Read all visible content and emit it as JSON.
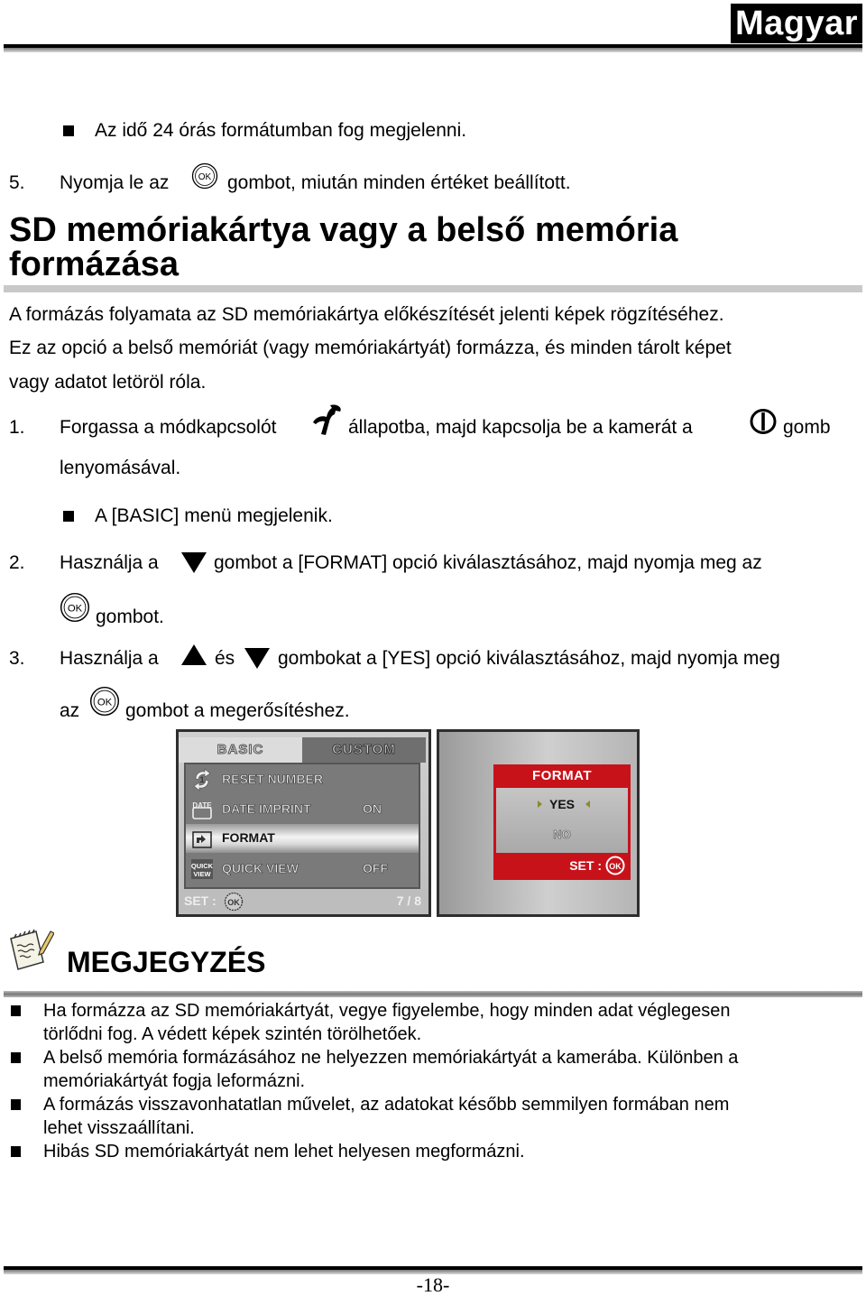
{
  "header": {
    "language_tab": "Magyar"
  },
  "intro": {
    "bullet": "Az idő 24 órás formátumban fog megjelenni.",
    "step5": {
      "number": "5.",
      "before": "Nyomja le az",
      "icon": "ok-button-icon",
      "after": "gombot, miután minden értéket beállított."
    }
  },
  "section": {
    "title_line1": "SD memóriakártya vagy a belső memória",
    "title_line2": "formázása",
    "paragraph_lines": [
      "A formázás folyamata az SD memóriakártya előkészítését jelenti képek rögzítéséhez.",
      "Ez az opció a belső memóriát (vagy memóriakártyát) formázza, és minden tárolt képet",
      "vagy adatot letöröl róla."
    ]
  },
  "steps": [
    {
      "number": "1.",
      "line1_a": "Forgassa a módkapcsolót",
      "icon1": "wrench-setup-icon",
      "line1_b": "állapotba, majd kapcsolja be a kamerát a",
      "icon2": "power-icon",
      "line1_c": "gomb",
      "line2": "lenyomásával.",
      "bullet": "A [BASIC] menü megjelenik."
    },
    {
      "number": "2.",
      "line1_a": "Használja a",
      "icon1": "down-arrow-icon",
      "line1_b": "gombot a [FORMAT] opció kiválasztásához, majd nyomja meg az",
      "icon2": "ok-button-icon",
      "line2": "gombot."
    },
    {
      "number": "3.",
      "line1_a": "Használja a",
      "icon1": "up-arrow-icon",
      "line1_b": "és",
      "icon2": "down-arrow-icon",
      "line1_c": "gombokat a [YES] opció kiválasztásához, majd nyomja meg",
      "line2_a": "az",
      "icon3": "ok-button-icon",
      "line2_b": "gombot a megerősítéshez."
    }
  ],
  "screen_basic": {
    "tabs": [
      {
        "label": "BASIC",
        "active": true
      },
      {
        "label": "CUSTOM",
        "active": false
      }
    ],
    "items": [
      {
        "icon": "reset-number-icon",
        "label": "RESET NUMBER",
        "value": ""
      },
      {
        "icon": "date-imprint-icon",
        "label": "DATE IMPRINT",
        "value": "ON"
      },
      {
        "icon": "format-icon",
        "label": "FORMAT",
        "value": "",
        "selected": true
      },
      {
        "icon": "quick-view-icon",
        "label": "QUICK VIEW",
        "value": "OFF"
      }
    ],
    "footer_set": "SET :",
    "footer_page": "7 / 8"
  },
  "screen_format": {
    "title": "FORMAT",
    "options": [
      "YES",
      "NO"
    ],
    "selected": "YES",
    "footer_set": "SET :",
    "accent": "#c8121a"
  },
  "note": {
    "title": "MEGJEGYZÉS",
    "items": [
      {
        "line1": "Ha formázza az SD memóriakártyát, vegye figyelembe, hogy minden adat véglegesen",
        "line2": "törlődni fog. A védett képek szintén törölhetőek."
      },
      {
        "line1": "A belső memória formázásához ne helyezzen memóriakártyát a kamerába. Különben a",
        "line2": "memóriakártyát fogja leformázni."
      },
      {
        "line1": "A formázás visszavonhatatlan művelet, az adatokat később semmilyen formában nem",
        "line2": "lehet visszaállítani."
      },
      {
        "line1": "Hibás SD memóriakártyát nem lehet helyesen megformázni.",
        "line2": ""
      }
    ]
  },
  "footer": {
    "page_number": "-18-"
  }
}
